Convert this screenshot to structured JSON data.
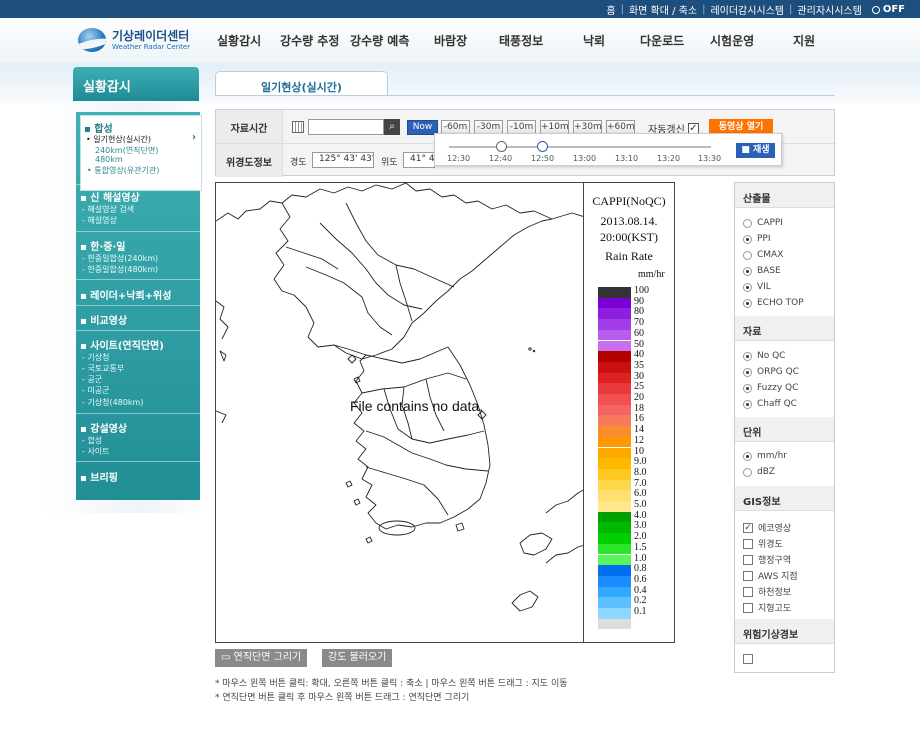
{
  "topbar": {
    "links": [
      "홈",
      "화면 확대 / 축소",
      "레이더감시시스템",
      "관리자시시스템"
    ],
    "off_label": "OFF"
  },
  "logo": {
    "title": "기상레이더센터",
    "subtitle": "Weather Radar Center"
  },
  "gnb": [
    "실황감시",
    "강수량 추정",
    "강수량 예측",
    "바람장",
    "태풍정보",
    "낙뢰",
    "다운로드",
    "시험운영",
    "지원"
  ],
  "lnb": {
    "title": "실황감시",
    "menus": [
      {
        "title": "합성",
        "subs": [
          "일기현상(실시간)",
          "240km(연직단면)",
          "480km",
          "통합영상(유관기관)"
        ]
      },
      {
        "title": "신 해설영상",
        "subs": [
          "해설영상 검색",
          "해설영상"
        ]
      },
      {
        "title": "한·중·일",
        "subs": [
          "한중일합성(240km)",
          "한중일합성(480km)"
        ]
      },
      {
        "title": "레이더+낙뢰+위성",
        "subs": []
      },
      {
        "title": "비교영상",
        "subs": []
      },
      {
        "title": "사이트(연직단면)",
        "subs": [
          "기상청",
          "국토교통부",
          "공군",
          "미공군",
          "기상청(480km)"
        ]
      },
      {
        "title": "강설영상",
        "subs": [
          "합성",
          "사이트"
        ]
      },
      {
        "title": "브리핑",
        "subs": []
      }
    ]
  },
  "tab": {
    "label": "일기현상(실시간)"
  },
  "controls": {
    "time_label": "자료시간",
    "coord_label": "위경도정보",
    "date_value": "",
    "time_buttons": [
      "Now",
      "-60m",
      "-30m",
      "-10m",
      "+10m",
      "+30m",
      "+60m"
    ],
    "auto_label": "자동갱신",
    "auto_checked": "✓",
    "anim_label": "동영상 열기",
    "lon_label": "경도",
    "lon_value": "125° 43' 43\"",
    "lat_label": "위도",
    "lat_value": "41° 4"
  },
  "timeline": {
    "ticks": [
      "12:30",
      "12:40",
      "12:50",
      "13:00",
      "13:10",
      "13:20",
      "13:30"
    ],
    "play_label": "■ 재생"
  },
  "map": {
    "message": "File contains no data."
  },
  "legend": {
    "title": "CAPPI(NoQC)",
    "date": "2013.08.14.",
    "time": "20:00(KST)",
    "product": "Rain Rate",
    "unit": "mm/hr",
    "levels": [
      {
        "v": "100",
        "c": "#333333"
      },
      {
        "v": "90",
        "c": "#7a00d6"
      },
      {
        "v": "80",
        "c": "#8c1ee0"
      },
      {
        "v": "70",
        "c": "#a23ce6"
      },
      {
        "v": "60",
        "c": "#b85cec"
      },
      {
        "v": "50",
        "c": "#c86ff0"
      },
      {
        "v": "40",
        "c": "#b30000"
      },
      {
        "v": "35",
        "c": "#cc1010"
      },
      {
        "v": "30",
        "c": "#dd2222"
      },
      {
        "v": "25",
        "c": "#e83a3a"
      },
      {
        "v": "20",
        "c": "#f05050"
      },
      {
        "v": "18",
        "c": "#f46464"
      },
      {
        "v": "16",
        "c": "#f87a5a"
      },
      {
        "v": "14",
        "c": "#fb8c30"
      },
      {
        "v": "12",
        "c": "#ff9900"
      },
      {
        "v": "10",
        "c": "#ffa800"
      },
      {
        "v": "9.0",
        "c": "#ffb800"
      },
      {
        "v": "8.0",
        "c": "#ffc820"
      },
      {
        "v": "7.0",
        "c": "#ffd84a"
      },
      {
        "v": "6.0",
        "c": "#ffe070"
      },
      {
        "v": "5.0",
        "c": "#ffe98c"
      },
      {
        "v": "4.0",
        "c": "#00a000"
      },
      {
        "v": "3.0",
        "c": "#00b800"
      },
      {
        "v": "2.0",
        "c": "#00d000"
      },
      {
        "v": "1.5",
        "c": "#2ae52a"
      },
      {
        "v": "1.0",
        "c": "#5af55a"
      },
      {
        "v": "0.8",
        "c": "#0070f0"
      },
      {
        "v": "0.6",
        "c": "#1a8cff"
      },
      {
        "v": "0.4",
        "c": "#33a8ff"
      },
      {
        "v": "0.2",
        "c": "#5cc0ff"
      },
      {
        "v": "0.1",
        "c": "#8cd8ff"
      },
      {
        "v": "",
        "c": "#dddddd"
      }
    ]
  },
  "map_buttons": [
    "연직단면 그리기",
    "강도 불러오기"
  ],
  "notes": [
    "* 마우스 왼쪽 버튼 클릭: 확대, 오른쪽 버튼 클릭 : 축소 | 마우스 왼쪽 버튼 드래그 : 지도 이동",
    "* 연직단면 버튼 클릭 후 마우스 왼쪽 버튼 드래그 : 연직단면 그리기"
  ],
  "right_panel": {
    "product_head": "산출물",
    "products": [
      {
        "label": "CAPPI",
        "on": false
      },
      {
        "label": "PPI",
        "on": true
      },
      {
        "label": "CMAX",
        "on": false
      },
      {
        "label": "BASE",
        "on": true
      },
      {
        "label": "VIL",
        "on": true
      },
      {
        "label": "ECHO TOP",
        "on": true
      }
    ],
    "data_head": "자료",
    "data": [
      {
        "label": "No QC",
        "on": true
      },
      {
        "label": "ORPG QC",
        "on": true
      },
      {
        "label": "Fuzzy QC",
        "on": true
      },
      {
        "label": "Chaff QC",
        "on": true
      }
    ],
    "unit_head": "단위",
    "units": [
      {
        "label": "mm/hr",
        "on": true
      },
      {
        "label": "dBZ",
        "on": false
      }
    ],
    "gis_head": "GIS정보",
    "gis": [
      {
        "label": "에코영상",
        "checked": "✓"
      },
      {
        "label": "위경도",
        "checked": ""
      },
      {
        "label": "행정구역",
        "checked": ""
      },
      {
        "label": "AWS 지점",
        "checked": ""
      },
      {
        "label": "하천정보",
        "checked": ""
      },
      {
        "label": "지형고도",
        "checked": ""
      }
    ],
    "warn_head": "위험기상경보"
  }
}
